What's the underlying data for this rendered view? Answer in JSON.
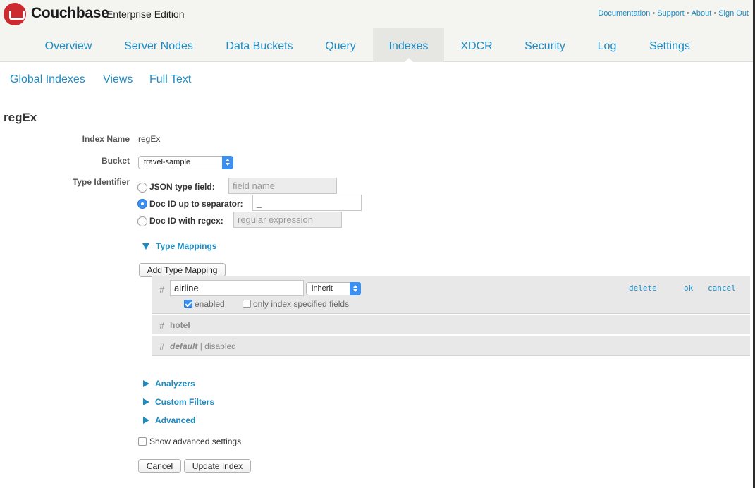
{
  "header": {
    "brand": "Couchbase",
    "edition": "Enterprise Edition",
    "links": [
      "Documentation",
      "Support",
      "About",
      "Sign Out"
    ],
    "separator": "•"
  },
  "nav": {
    "items": [
      "Overview",
      "Server Nodes",
      "Data Buckets",
      "Query",
      "Indexes",
      "XDCR",
      "Security",
      "Log",
      "Settings"
    ],
    "active": "Indexes"
  },
  "subnav": {
    "items": [
      "Global Indexes",
      "Views",
      "Full Text"
    ]
  },
  "page": {
    "title": "regEx"
  },
  "form": {
    "index_name_label": "Index Name",
    "index_name_value": "regEx",
    "bucket_label": "Bucket",
    "bucket_value": "travel-sample",
    "type_identifier_label": "Type Identifier",
    "json_type_label": "JSON type field:",
    "json_type_placeholder": "field name",
    "docid_sep_label": "Doc ID up to separator:",
    "docid_sep_value": "_",
    "docid_regex_label": "Doc ID with regex:",
    "docid_regex_placeholder": "regular expression",
    "selected_type": "Doc ID up to separator:"
  },
  "type_mappings": {
    "title": "Type Mappings",
    "add_button": "Add Type Mapping",
    "hash": "#",
    "editing": {
      "name": "airline",
      "analyzer": "inherit",
      "enabled_label": "enabled",
      "enabled": true,
      "only_specified_label": "only index specified fields",
      "only_specified": false,
      "actions": [
        "delete",
        "ok",
        "cancel"
      ]
    },
    "rows": [
      {
        "name": "hotel",
        "suffix": ""
      },
      {
        "name": "default",
        "suffix": "| disabled"
      }
    ]
  },
  "sections": [
    "Analyzers",
    "Custom Filters",
    "Advanced"
  ],
  "show_advanced_label": "Show advanced settings",
  "buttons": {
    "cancel": "Cancel",
    "update": "Update Index"
  },
  "colors": {
    "link": "#1e8bc3",
    "brand_red": "#cc2a2f",
    "select_accent": "#3b8ff0"
  }
}
